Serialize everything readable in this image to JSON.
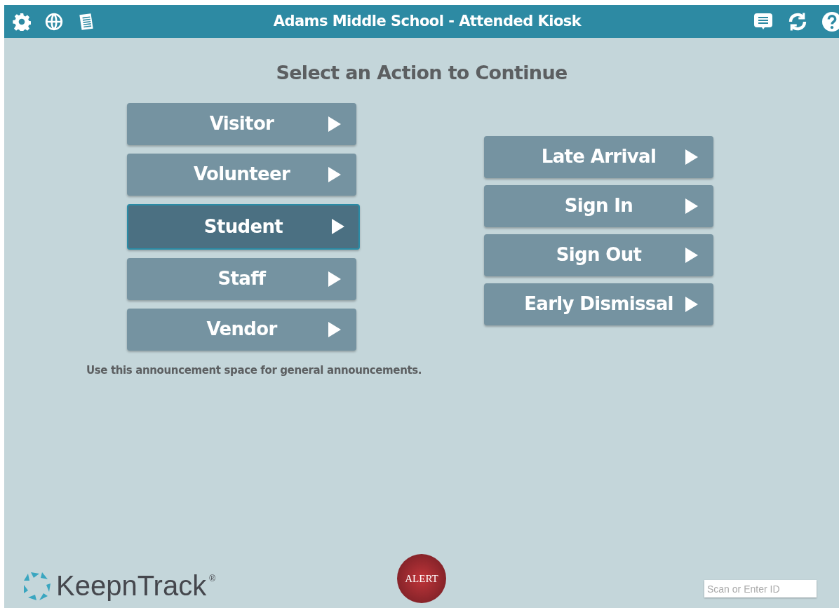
{
  "header": {
    "title": "Adams Middle School - Attended Kiosk"
  },
  "heading": "Select an Action to Continue",
  "left_actions": [
    {
      "label": "Visitor",
      "selected": false
    },
    {
      "label": "Volunteer",
      "selected": false
    },
    {
      "label": "Student",
      "selected": true
    },
    {
      "label": "Staff",
      "selected": false
    },
    {
      "label": "Vendor",
      "selected": false
    }
  ],
  "right_actions": [
    {
      "label": "Late Arrival",
      "selected": false
    },
    {
      "label": "Sign In",
      "selected": false
    },
    {
      "label": "Sign Out",
      "selected": false
    },
    {
      "label": "Early Dismissal",
      "selected": false
    }
  ],
  "announcement": "Use this announcement space for general announcements.",
  "logo": {
    "text": "KeepnTrack",
    "mark": "®"
  },
  "alert_button": "ALERT",
  "id_field": {
    "placeholder": "Scan or Enter ID"
  }
}
